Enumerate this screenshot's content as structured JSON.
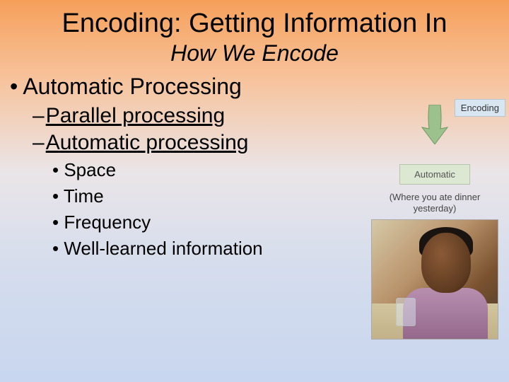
{
  "title": "Encoding: Getting Information In",
  "subtitle": "How We Encode",
  "bullets": {
    "l1": "• Automatic Processing",
    "l2a": "Parallel processing",
    "l2b": "Automatic processing",
    "l3a": "• Space",
    "l3b": "• Time",
    "l3c": "• Frequency",
    "l3d": "• Well-learned information"
  },
  "figure": {
    "encoding_label": "Encoding",
    "automatic_label": "Automatic",
    "caption": "(Where you ate dinner yesterday)"
  }
}
